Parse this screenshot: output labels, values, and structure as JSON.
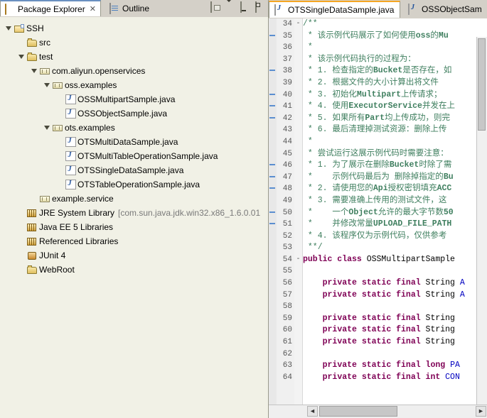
{
  "left_panel": {
    "tabs": [
      {
        "label": "Package Explorer",
        "icon": "package-explorer-icon",
        "active": true,
        "close": "✕"
      },
      {
        "label": "Outline",
        "icon": "outline-icon",
        "active": false
      }
    ],
    "toolbar": [
      {
        "name": "link-with-editor-button",
        "icon": "link-editor-icon"
      },
      {
        "name": "view-menu-button",
        "icon": "chevron-down-icon"
      },
      {
        "name": "minimize-button",
        "icon": "minimize-icon"
      },
      {
        "name": "maximize-button",
        "icon": "maximize-icon"
      }
    ],
    "tree": [
      {
        "indent": 0,
        "twisty": "open",
        "icon": "project-icon",
        "label": "SSH",
        "note": ""
      },
      {
        "indent": 1,
        "twisty": "none",
        "icon": "source-folder-icon",
        "label": "src",
        "note": ""
      },
      {
        "indent": 1,
        "twisty": "open",
        "icon": "source-folder-icon",
        "label": "test",
        "note": ""
      },
      {
        "indent": 2,
        "twisty": "open",
        "icon": "package-icon",
        "label": "com.aliyun.openservices",
        "note": ""
      },
      {
        "indent": 3,
        "twisty": "open",
        "icon": "package-icon",
        "label": "oss.examples",
        "note": ""
      },
      {
        "indent": 4,
        "twisty": "none",
        "icon": "java-file-icon",
        "label": "OSSMultipartSample.java",
        "note": ""
      },
      {
        "indent": 4,
        "twisty": "none",
        "icon": "java-file-icon",
        "label": "OSSObjectSample.java",
        "note": ""
      },
      {
        "indent": 3,
        "twisty": "open",
        "icon": "package-icon",
        "label": "ots.examples",
        "note": ""
      },
      {
        "indent": 4,
        "twisty": "none",
        "icon": "java-file-icon",
        "label": "OTSMultiDataSample.java",
        "note": ""
      },
      {
        "indent": 4,
        "twisty": "none",
        "icon": "java-file-icon",
        "label": "OTSMultiTableOperationSample.java",
        "note": ""
      },
      {
        "indent": 4,
        "twisty": "none",
        "icon": "java-file-icon",
        "label": "OTSSingleDataSample.java",
        "note": ""
      },
      {
        "indent": 4,
        "twisty": "none",
        "icon": "java-file-icon",
        "label": "OTSTableOperationSample.java",
        "note": ""
      },
      {
        "indent": 2,
        "twisty": "none",
        "icon": "package-icon",
        "label": "example.service",
        "note": ""
      },
      {
        "indent": 1,
        "twisty": "none",
        "icon": "library-icon",
        "label": "JRE System Library",
        "note": "[com.sun.java.jdk.win32.x86_1.6.0.01"
      },
      {
        "indent": 1,
        "twisty": "none",
        "icon": "library-icon",
        "label": "Java EE 5 Libraries",
        "note": ""
      },
      {
        "indent": 1,
        "twisty": "none",
        "icon": "library-icon",
        "label": "Referenced Libraries",
        "note": ""
      },
      {
        "indent": 1,
        "twisty": "none",
        "icon": "junit-icon",
        "label": "JUnit 4",
        "note": ""
      },
      {
        "indent": 1,
        "twisty": "none",
        "icon": "folder-icon",
        "label": "WebRoot",
        "note": ""
      }
    ]
  },
  "editor": {
    "tabs": [
      {
        "label": "OTSSingleDataSample.java",
        "icon": "java-file-icon",
        "active": true
      },
      {
        "label": "OSSObjectSam",
        "icon": "java-file-icon",
        "active": false
      }
    ],
    "first_line_number": 34,
    "lines": [
      {
        "n": 34,
        "fold": "-",
        "mark": false,
        "segments": [
          {
            "t": "/**",
            "c": "cm"
          }
        ]
      },
      {
        "n": 35,
        "fold": "",
        "mark": true,
        "segments": [
          {
            "t": " * 该示例代码展示了如何使用",
            "c": "cm"
          },
          {
            "t": "oss",
            "c": "cmb"
          },
          {
            "t": "的",
            "c": "cm"
          },
          {
            "t": "Mu",
            "c": "cmb"
          }
        ]
      },
      {
        "n": 36,
        "fold": "",
        "mark": false,
        "segments": [
          {
            "t": " *",
            "c": "cm"
          }
        ]
      },
      {
        "n": 37,
        "fold": "",
        "mark": false,
        "segments": [
          {
            "t": " * 该示例代码执行的过程为：",
            "c": "cm"
          }
        ]
      },
      {
        "n": 38,
        "fold": "",
        "mark": true,
        "segments": [
          {
            "t": " * 1. 检查指定的",
            "c": "cm"
          },
          {
            "t": "Bucket",
            "c": "cmb"
          },
          {
            "t": "是否存在，如",
            "c": "cm"
          }
        ]
      },
      {
        "n": 39,
        "fold": "",
        "mark": false,
        "segments": [
          {
            "t": " * 2. 根据文件的大小计算出将文件",
            "c": "cm"
          }
        ]
      },
      {
        "n": 40,
        "fold": "",
        "mark": true,
        "segments": [
          {
            "t": " * 3. 初始化",
            "c": "cm"
          },
          {
            "t": "Multipart",
            "c": "cmb"
          },
          {
            "t": "上传请求；",
            "c": "cm"
          }
        ]
      },
      {
        "n": 41,
        "fold": "",
        "mark": true,
        "segments": [
          {
            "t": " * 4. 使用",
            "c": "cm"
          },
          {
            "t": "ExecutorService",
            "c": "cmb"
          },
          {
            "t": "并发在上",
            "c": "cm"
          }
        ]
      },
      {
        "n": 42,
        "fold": "",
        "mark": true,
        "segments": [
          {
            "t": " * 5. 如果所有",
            "c": "cm"
          },
          {
            "t": "Part",
            "c": "cmb"
          },
          {
            "t": "均上传成功，则完",
            "c": "cm"
          }
        ]
      },
      {
        "n": 43,
        "fold": "",
        "mark": false,
        "segments": [
          {
            "t": " * 6. 最后清理掉测试资源：删除上传",
            "c": "cm"
          }
        ]
      },
      {
        "n": 44,
        "fold": "",
        "mark": false,
        "segments": [
          {
            "t": " *",
            "c": "cm"
          }
        ]
      },
      {
        "n": 45,
        "fold": "",
        "mark": false,
        "segments": [
          {
            "t": " * 尝试运行这展示例代码时需要注意：",
            "c": "cm"
          }
        ]
      },
      {
        "n": 46,
        "fold": "",
        "mark": true,
        "segments": [
          {
            "t": " * 1. 为了展示在删除",
            "c": "cm"
          },
          {
            "t": "Bucket",
            "c": "cmb"
          },
          {
            "t": "时除了需",
            "c": "cm"
          }
        ]
      },
      {
        "n": 47,
        "fold": "",
        "mark": true,
        "segments": [
          {
            "t": " *    示例代码最后为 删除掉指定的",
            "c": "cm"
          },
          {
            "t": "Bu",
            "c": "cmb"
          }
        ]
      },
      {
        "n": 48,
        "fold": "",
        "mark": true,
        "segments": [
          {
            "t": " * 2. 请使用您的",
            "c": "cm"
          },
          {
            "t": "Api",
            "c": "cmb"
          },
          {
            "t": "授权密钥填充",
            "c": "cm"
          },
          {
            "t": "ACC",
            "c": "cmb"
          }
        ]
      },
      {
        "n": 49,
        "fold": "",
        "mark": false,
        "segments": [
          {
            "t": " * 3. 需要准确上传用的测试文件，这",
            "c": "cm"
          }
        ]
      },
      {
        "n": 50,
        "fold": "",
        "mark": true,
        "segments": [
          {
            "t": " *    一个",
            "c": "cm"
          },
          {
            "t": "Object",
            "c": "cmb"
          },
          {
            "t": "允许的最大字节数",
            "c": "cm"
          },
          {
            "t": "50",
            "c": "cmb"
          }
        ]
      },
      {
        "n": 51,
        "fold": "",
        "mark": true,
        "segments": [
          {
            "t": " *    并修改常量",
            "c": "cm"
          },
          {
            "t": "UPLOAD_FILE_PATH",
            "c": "cmb"
          }
        ]
      },
      {
        "n": 52,
        "fold": "",
        "mark": false,
        "segments": [
          {
            "t": " * 4. 该程序仅为示例代码，仅供参考",
            "c": "cm"
          }
        ]
      },
      {
        "n": 53,
        "fold": "",
        "mark": false,
        "segments": [
          {
            "t": " **/",
            "c": "cm"
          }
        ]
      },
      {
        "n": 54,
        "fold": "-",
        "mark": false,
        "segments": [
          {
            "t": "public class ",
            "c": "kw"
          },
          {
            "t": "OSSMultipartSample",
            "c": "cls"
          }
        ]
      },
      {
        "n": 55,
        "fold": "",
        "mark": false,
        "segments": [
          {
            "t": "",
            "c": "cls"
          }
        ]
      },
      {
        "n": 56,
        "fold": "",
        "mark": false,
        "segments": [
          {
            "t": "    ",
            "c": "cls"
          },
          {
            "t": "private static final ",
            "c": "kw"
          },
          {
            "t": "String ",
            "c": "cls"
          },
          {
            "t": "A",
            "c": "fld"
          }
        ]
      },
      {
        "n": 57,
        "fold": "",
        "mark": false,
        "segments": [
          {
            "t": "    ",
            "c": "cls"
          },
          {
            "t": "private static final ",
            "c": "kw"
          },
          {
            "t": "String ",
            "c": "cls"
          },
          {
            "t": "A",
            "c": "fld"
          }
        ]
      },
      {
        "n": 58,
        "fold": "",
        "mark": false,
        "segments": [
          {
            "t": "",
            "c": "cls"
          }
        ]
      },
      {
        "n": 59,
        "fold": "",
        "mark": false,
        "segments": [
          {
            "t": "    ",
            "c": "cls"
          },
          {
            "t": "private static final ",
            "c": "kw"
          },
          {
            "t": "String ",
            "c": "cls"
          }
        ]
      },
      {
        "n": 60,
        "fold": "",
        "mark": false,
        "segments": [
          {
            "t": "    ",
            "c": "cls"
          },
          {
            "t": "private static final ",
            "c": "kw"
          },
          {
            "t": "String ",
            "c": "cls"
          }
        ]
      },
      {
        "n": 61,
        "fold": "",
        "mark": false,
        "segments": [
          {
            "t": "    ",
            "c": "cls"
          },
          {
            "t": "private static final ",
            "c": "kw"
          },
          {
            "t": "String ",
            "c": "cls"
          }
        ]
      },
      {
        "n": 62,
        "fold": "",
        "mark": false,
        "segments": [
          {
            "t": "",
            "c": "cls"
          }
        ]
      },
      {
        "n": 63,
        "fold": "",
        "mark": false,
        "segments": [
          {
            "t": "    ",
            "c": "cls"
          },
          {
            "t": "private static final ",
            "c": "kw"
          },
          {
            "t": "long ",
            "c": "kw"
          },
          {
            "t": "PA",
            "c": "fld"
          }
        ]
      },
      {
        "n": 64,
        "fold": "",
        "mark": false,
        "segments": [
          {
            "t": "    ",
            "c": "cls"
          },
          {
            "t": "private static final ",
            "c": "kw"
          },
          {
            "t": "int ",
            "c": "kw"
          },
          {
            "t": "CON",
            "c": "fld"
          }
        ]
      }
    ],
    "scrollbar": {
      "h_left_arrow": "◄",
      "h_right_arrow": "►"
    }
  }
}
